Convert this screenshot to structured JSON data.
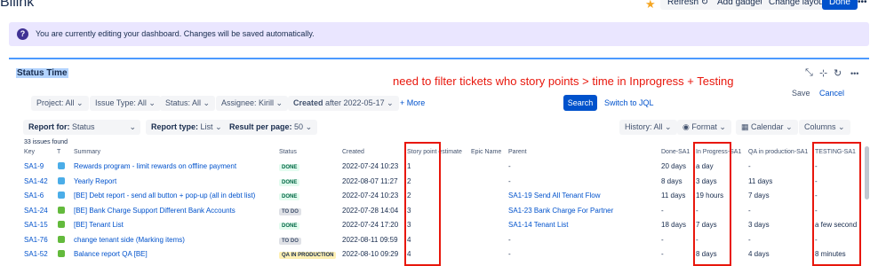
{
  "header": {
    "app_title": "Bllink",
    "refresh_label": "Refresh",
    "add_gadget_label": "Add gadget",
    "change_layout_label": "Change layout",
    "done_label": "Done",
    "more_label": "•••"
  },
  "banner": {
    "text": "You are currently editing your dashboard. Changes will be saved automatically."
  },
  "gadget": {
    "title": "Status Time",
    "save_label": "Save",
    "cancel_label": "Cancel",
    "annotation": "need to filter tickets who story points > time in Inprogress + Testing"
  },
  "filters": {
    "project": "Project: All",
    "issue_type": "Issue Type: All",
    "status": "Status: All",
    "assignee": "Assignee: Kirill",
    "created_label": "Created",
    "created_value": "after 2022-05-17",
    "more_label": "+ More",
    "search_label": "Search",
    "jql_label": "Switch to JQL"
  },
  "options": {
    "report_for_label": "Report for:",
    "report_for_value": "Status",
    "report_type_label": "Report type:",
    "report_type_value": "List",
    "per_page_label": "Result per page:",
    "per_page_value": "50",
    "history": "History: All",
    "format": "Format",
    "calendar": "Calendar",
    "columns": "Columns"
  },
  "table": {
    "issues_found": "33 issues found",
    "headers": {
      "key": "Key",
      "type": "T",
      "summary": "Summary",
      "status": "Status",
      "created": "Created",
      "story_points": "Story point estimate",
      "epic_name": "Epic Name",
      "parent": "Parent",
      "done": "Done-SA1",
      "in_progress": "In Progress-SA1",
      "qa": "QA in production-SA1",
      "testing": "TESTING-SA1"
    },
    "rows": [
      {
        "key": "SA1-9",
        "type": "task",
        "summary": "Rewards program - limit rewards on offline payment",
        "status": "DONE",
        "status_kind": "done",
        "created": "2022-07-24 10:23",
        "sp": "1",
        "parent": "-",
        "parent_link": false,
        "done": "20 days",
        "in_progress": "a day",
        "qa": "-",
        "testing": "-"
      },
      {
        "key": "SA1-42",
        "type": "task",
        "summary": "Yearly Report",
        "status": "DONE",
        "status_kind": "done",
        "created": "2022-08-07 11:27",
        "sp": "2",
        "parent": "-",
        "parent_link": false,
        "done": "8 days",
        "in_progress": "3 days",
        "qa": "11 days",
        "testing": "-"
      },
      {
        "key": "SA1-6",
        "type": "task",
        "summary": "[BE] Debt report - send all button + pop-up (all in debt list)",
        "status": "DONE",
        "status_kind": "done",
        "created": "2022-07-24 10:23",
        "sp": "2",
        "parent": "SA1-19 Send All Tenant Flow",
        "parent_link": true,
        "done": "11 days",
        "in_progress": "19 hours",
        "qa": "7 days",
        "testing": "-"
      },
      {
        "key": "SA1-24",
        "type": "story",
        "summary": "[BE] Bank Charge Support Different Bank Accounts",
        "status": "TO DO",
        "status_kind": "todo",
        "created": "2022-07-28 14:04",
        "sp": "3",
        "parent": "SA1-23 Bank Charge For Partner",
        "parent_link": true,
        "done": "-",
        "in_progress": "-",
        "qa": "-",
        "testing": "-"
      },
      {
        "key": "SA1-15",
        "type": "story",
        "summary": "[BE] Tenant List",
        "status": "DONE",
        "status_kind": "done",
        "created": "2022-07-24 17:20",
        "sp": "3",
        "parent": "SA1-14 Tenant List",
        "parent_link": true,
        "done": "18 days",
        "in_progress": "7 days",
        "qa": "3 days",
        "testing": "a few second"
      },
      {
        "key": "SA1-76",
        "type": "story",
        "summary": "change tenant side (Marking items)",
        "status": "TO DO",
        "status_kind": "todo",
        "created": "2022-08-11 09:59",
        "sp": "4",
        "parent": "-",
        "parent_link": false,
        "done": "-",
        "in_progress": "-",
        "qa": "-",
        "testing": "-"
      },
      {
        "key": "SA1-52",
        "type": "story",
        "summary": "Balance report QA [BE]",
        "status": "QA IN PRODUCTION",
        "status_kind": "qa",
        "created": "2022-08-10 09:29",
        "sp": "4",
        "parent": "-",
        "parent_link": false,
        "done": "-",
        "in_progress": "8 days",
        "qa": "4 days",
        "testing": "8 minutes"
      }
    ]
  }
}
